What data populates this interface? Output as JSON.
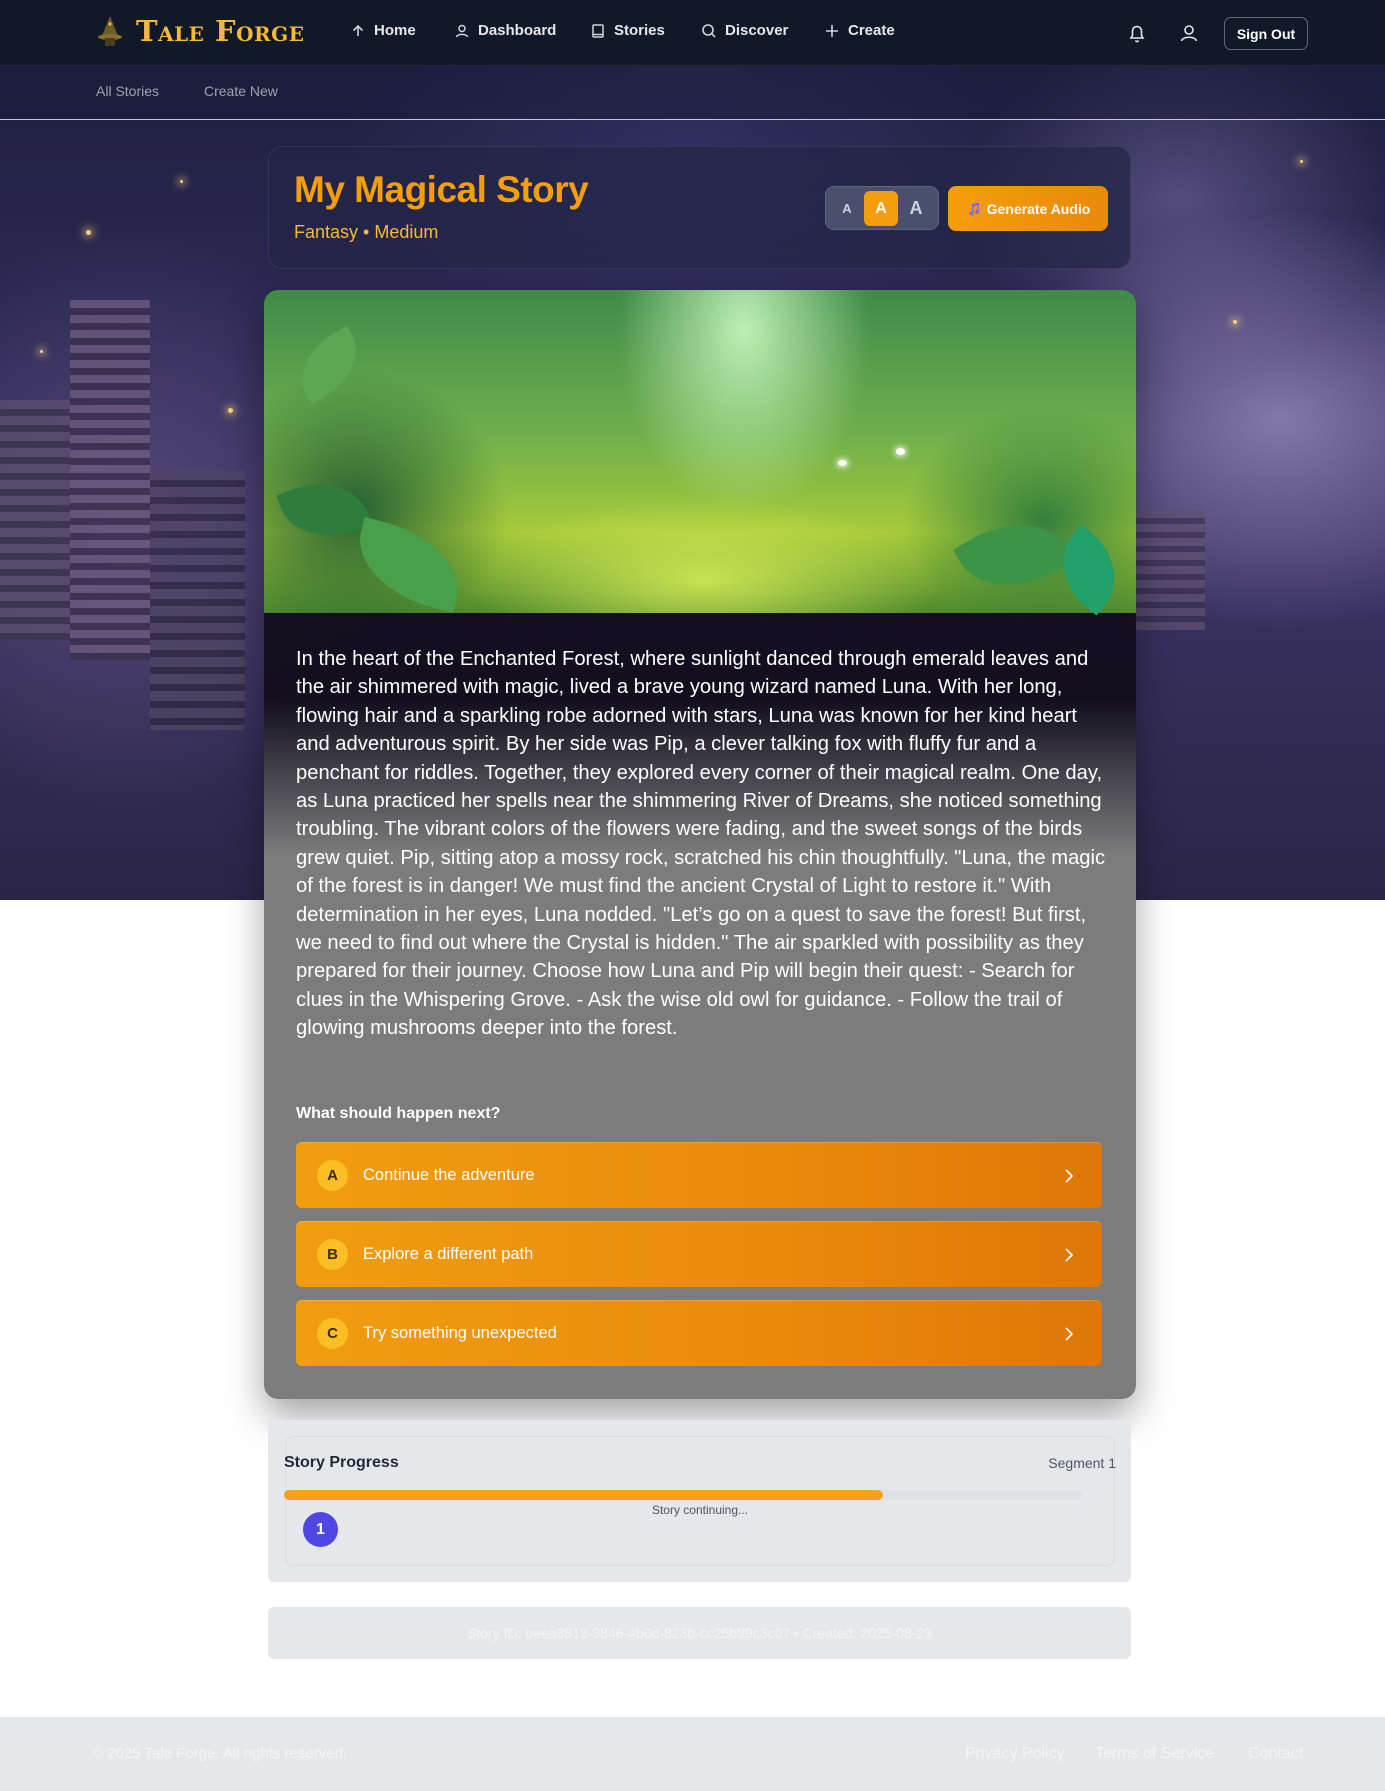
{
  "brand": {
    "name": "Tale Forge"
  },
  "nav": {
    "items": [
      {
        "label": "Home",
        "icon": "home-icon"
      },
      {
        "label": "Dashboard",
        "icon": "user-icon"
      },
      {
        "label": "Stories",
        "icon": "book-icon"
      },
      {
        "label": "Discover",
        "icon": "search-icon"
      },
      {
        "label": "Create",
        "icon": "plus-icon"
      }
    ],
    "sign_out": "Sign Out"
  },
  "subnav": {
    "items": [
      "All Stories",
      "Create New"
    ]
  },
  "story": {
    "title": "My Magical Story",
    "meta": "Fantasy • Medium",
    "font_sizes": [
      "A",
      "A",
      "A"
    ],
    "font_size_selected": "medium",
    "generate_audio": "Generate Audio",
    "text": "In the heart of the Enchanted Forest, where sunlight danced through emerald leaves and the air shimmered with magic, lived a brave young wizard named Luna. With her long, flowing hair and a sparkling robe adorned with stars, Luna was known for her kind heart and adventurous spirit. By her side was Pip, a clever talking fox with fluffy fur and a penchant for riddles. Together, they explored every corner of their magical realm. One day, as Luna practiced her spells near the shimmering River of Dreams, she noticed something troubling. The vibrant colors of the flowers were fading, and the sweet songs of the birds grew quiet. Pip, sitting atop a mossy rock, scratched his chin thoughtfully. \"Luna, the magic of the forest is in danger! We must find the ancient Crystal of Light to restore it.\" With determination in her eyes, Luna nodded. \"Let’s go on a quest to save the forest! But first, we need to find out where the Crystal is hidden.\" The air sparkled with possibility as they prepared for their journey. Choose how Luna and Pip will begin their quest: - Search for clues in the Whispering Grove. - Ask the wise old owl for guidance. - Follow the trail of glowing mushrooms deeper into the forest.",
    "next_prompt": "What should happen next?",
    "choices": [
      {
        "letter": "A",
        "label": "Continue the adventure"
      },
      {
        "letter": "B",
        "label": "Explore a different path"
      },
      {
        "letter": "C",
        "label": "Try something unexpected"
      }
    ]
  },
  "progress": {
    "title": "Story Progress",
    "segment_label": "Segment 1",
    "fraction": 0.75,
    "caption": "Story continuing...",
    "segments": [
      "1"
    ]
  },
  "story_info": "Story ID: beea8813-3846-4b0d-823b-cc25b99c3c07 • Created: 2025-08-23",
  "footer": {
    "copyright": "© 2025 Tale Forge. All rights reserved.",
    "links": [
      "Privacy Policy",
      "Terms of Service",
      "Contact"
    ]
  },
  "colors": {
    "accent": "#f59e0b",
    "nav_bg": "#111827",
    "progress_fill": "#f5a11c",
    "segment_dot": "#4f46e5"
  }
}
